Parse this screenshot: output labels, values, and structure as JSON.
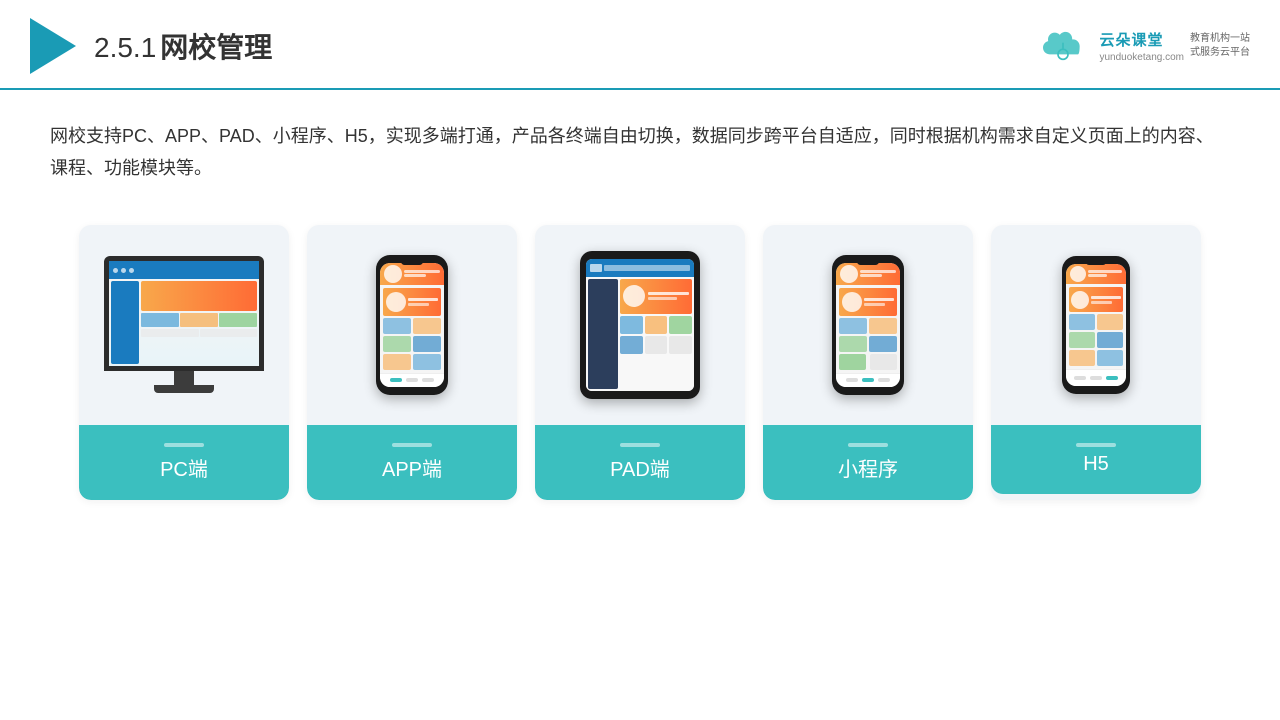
{
  "header": {
    "section_num": "2.5.1",
    "title": "网校管理",
    "brand_name": "云朵课堂",
    "brand_url": "yunduoketang.com",
    "brand_tagline_line1": "教育机构一站",
    "brand_tagline_line2": "式服务云平台"
  },
  "description": "网校支持PC、APP、PAD、小程序、H5，实现多端打通，产品各终端自由切换，数据同步跨平台自适应，同时根据机构需求自定义页面上的内容、课程、功能模块等。",
  "cards": [
    {
      "id": "pc",
      "label": "PC端"
    },
    {
      "id": "app",
      "label": "APP端"
    },
    {
      "id": "pad",
      "label": "PAD端"
    },
    {
      "id": "miniprogram",
      "label": "小程序"
    },
    {
      "id": "h5",
      "label": "H5"
    }
  ],
  "accent_color": "#3bbfbf"
}
